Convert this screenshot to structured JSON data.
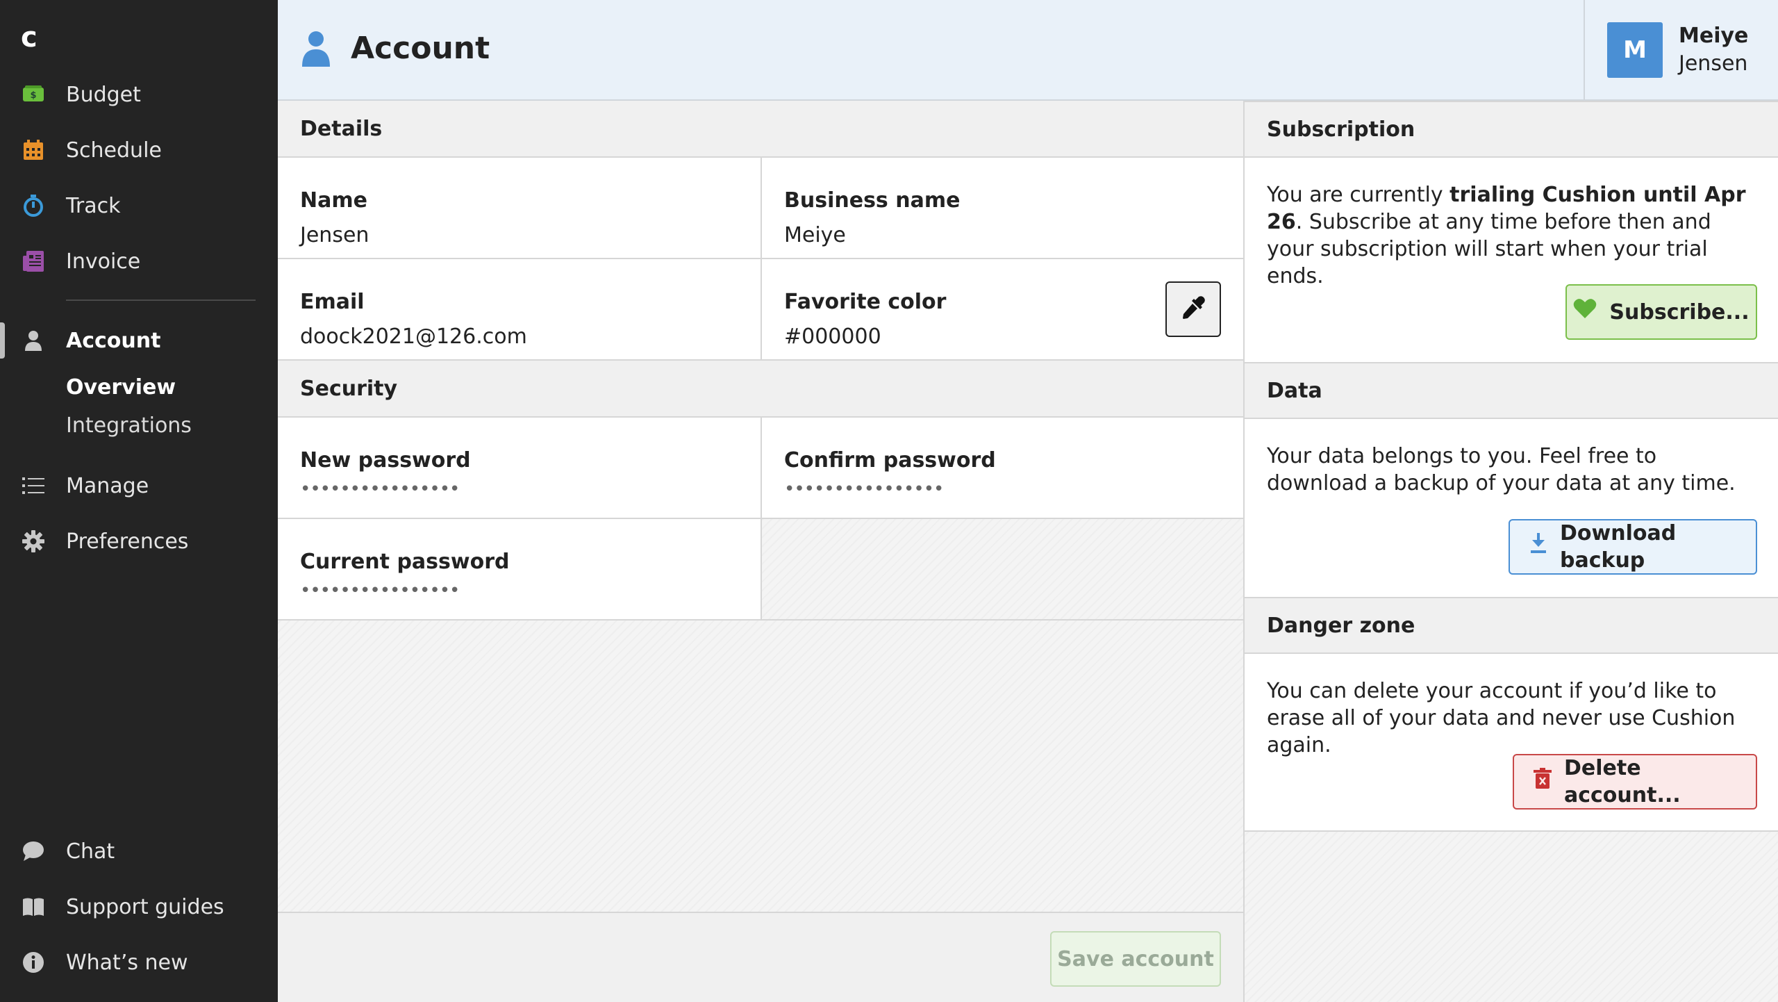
{
  "sidebar": {
    "logo": "c",
    "items": [
      {
        "label": "Budget",
        "icon": "budget-icon"
      },
      {
        "label": "Schedule",
        "icon": "calendar-icon"
      },
      {
        "label": "Track",
        "icon": "stopwatch-icon"
      },
      {
        "label": "Invoice",
        "icon": "invoice-icon"
      }
    ],
    "account": {
      "label": "Account",
      "icon": "user-icon"
    },
    "subitems": [
      {
        "label": "Overview"
      },
      {
        "label": "Integrations"
      }
    ],
    "manage": {
      "label": "Manage",
      "icon": "list-icon"
    },
    "preferences": {
      "label": "Preferences",
      "icon": "gear-icon"
    },
    "bottom": [
      {
        "label": "Chat",
        "icon": "chat-icon"
      },
      {
        "label": "Support guides",
        "icon": "book-icon"
      },
      {
        "label": "What’s new",
        "icon": "info-icon"
      }
    ]
  },
  "header": {
    "title": "Account",
    "user": {
      "initial": "M",
      "first": "Meiye",
      "last": "Jensen"
    }
  },
  "details": {
    "heading": "Details",
    "name_label": "Name",
    "name_value": "Jensen",
    "business_label": "Business name",
    "business_value": "Meiye",
    "email_label": "Email",
    "email_value": "doock2021@126.com",
    "color_label": "Favorite color",
    "color_value": "#000000"
  },
  "security": {
    "heading": "Security",
    "new_label": "New password",
    "new_value": "••••••••••••••••",
    "confirm_label": "Confirm password",
    "confirm_value": "••••••••••••••••",
    "current_label": "Current password",
    "current_value": "••••••••••••••••"
  },
  "footer": {
    "save_label": "Save account"
  },
  "subscription": {
    "heading": "Subscription",
    "text_pre": "You are currently ",
    "text_bold": "trialing Cushion until Apr 26",
    "text_post": ". Subscribe at any time before then and your subscription will start when your trial ends.",
    "button": "Subscribe..."
  },
  "data_section": {
    "heading": "Data",
    "text": "Your data belongs to you. Feel free to download a backup of your data at any time.",
    "button": "Download backup"
  },
  "danger": {
    "heading": "Danger zone",
    "text": "You can delete your account if you’d like to erase all of your data and never use Cushion again.",
    "button": "Delete account..."
  },
  "colors": {
    "sidebar_bg": "#242424",
    "header_bg": "#e9f1f9",
    "accent_blue": "#4a8fd4",
    "subscribe_green": "#7bbf4a",
    "danger_red": "#c84848"
  }
}
